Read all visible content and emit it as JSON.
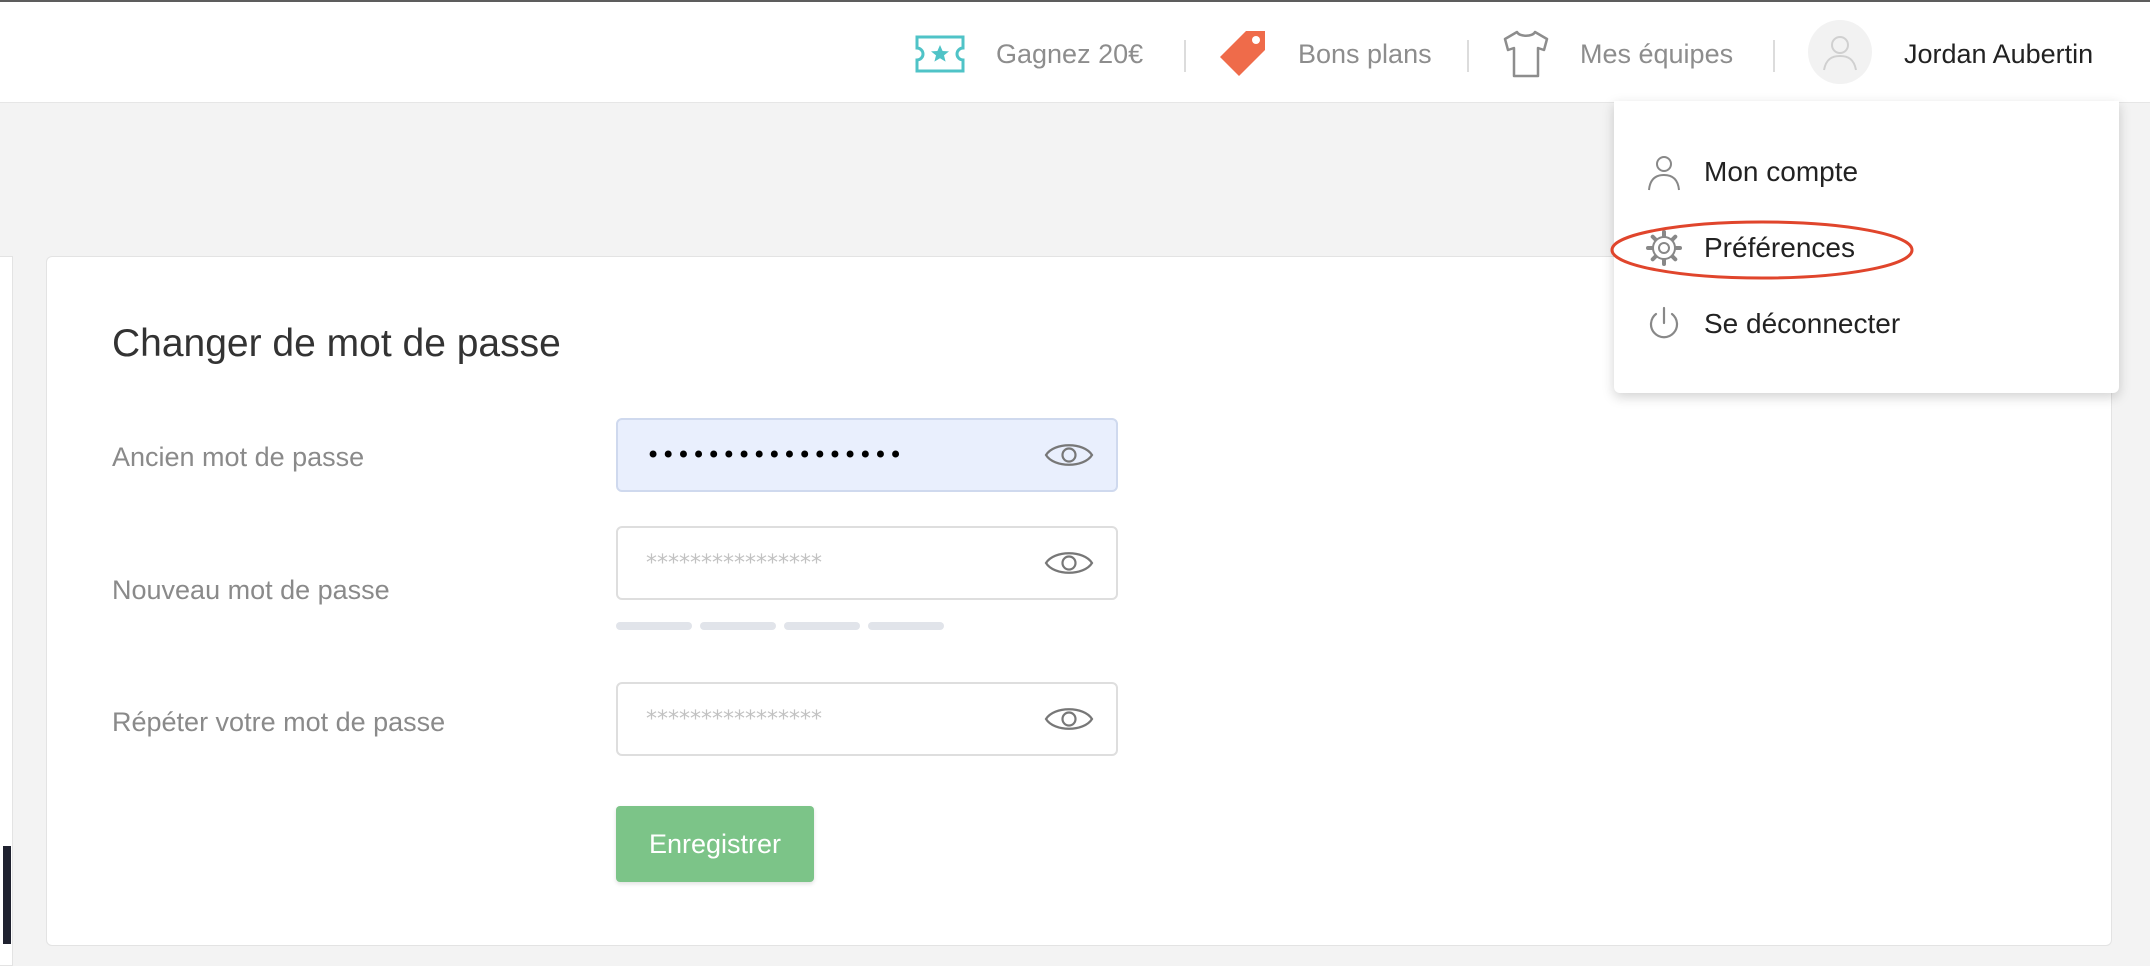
{
  "header": {
    "referral_label": "Gagnez 20€",
    "deals_label": "Bons plans",
    "teams_label": "Mes équipes",
    "user_name": "Jordan Aubertin",
    "icons": {
      "referral": "ticket-star-icon",
      "deals": "price-tag-icon",
      "teams": "jersey-icon",
      "avatar": "user-avatar-icon"
    }
  },
  "dropdown": {
    "items": [
      {
        "label": "Mon compte",
        "icon": "user-icon"
      },
      {
        "label": "Préférences",
        "icon": "gear-icon",
        "highlighted": true
      },
      {
        "label": "Se déconnecter",
        "icon": "power-icon"
      }
    ]
  },
  "password_form": {
    "title": "Changer de mot de passe",
    "old_password": {
      "label": "Ancien mot de passe",
      "value": "•••••••••••••••••"
    },
    "new_password": {
      "label": "Nouveau mot de passe",
      "placeholder": "****************"
    },
    "repeat_password": {
      "label": "Répéter votre mot de passe",
      "placeholder": "****************"
    },
    "strength_segments_filled": 0,
    "strength_segments_total": 4,
    "save_label": "Enregistrer"
  },
  "colors": {
    "accent_teal": "#4fc3c7",
    "tag_orange": "#ef6b4a",
    "save_green": "#7cc488",
    "highlight_red": "#e0452c",
    "filled_input_bg": "#e9effd"
  }
}
